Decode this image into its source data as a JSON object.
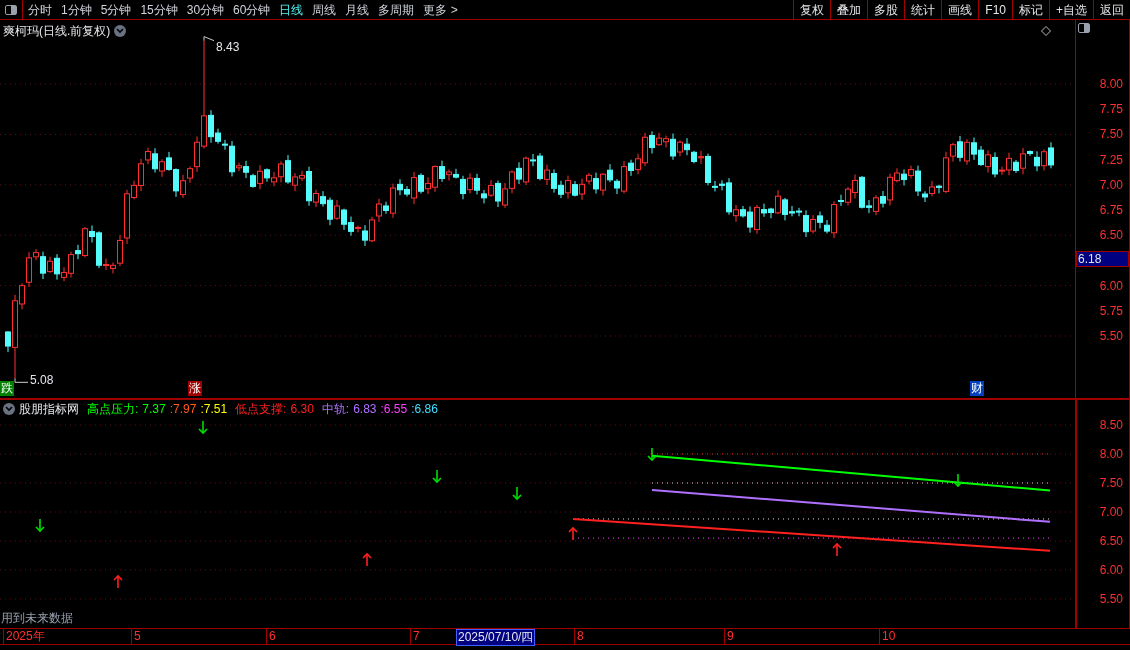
{
  "toolbar": {
    "tabs": [
      {
        "label": "分时",
        "selected": false
      },
      {
        "label": "1分钟",
        "selected": false
      },
      {
        "label": "5分钟",
        "selected": false
      },
      {
        "label": "15分钟",
        "selected": false
      },
      {
        "label": "30分钟",
        "selected": false
      },
      {
        "label": "60分钟",
        "selected": false
      },
      {
        "label": "日线",
        "selected": true
      },
      {
        "label": "周线",
        "selected": false
      },
      {
        "label": "月线",
        "selected": false
      },
      {
        "label": "多周期",
        "selected": false
      },
      {
        "label": "更多 >",
        "selected": false
      }
    ],
    "buttons": [
      "复权",
      "叠加",
      "多股",
      "统计",
      "画线",
      "F10",
      "标记",
      "+自选",
      "返回"
    ]
  },
  "main_chart": {
    "title": "爽柯玛(日线.前复权)",
    "high_label": "8.43",
    "low_label": "5.08",
    "y_axis": [
      "8.00",
      "7.75",
      "7.50",
      "7.25",
      "7.00",
      "6.75",
      "6.50",
      "6.00",
      "5.75",
      "5.50"
    ],
    "current_price": "6.18",
    "markers": [
      {
        "text": "跌",
        "kind": "fall"
      },
      {
        "text": "涨",
        "kind": "rise"
      },
      {
        "text": "财",
        "kind": "finance"
      }
    ]
  },
  "indicator": {
    "name": "股朋指标网",
    "groups": [
      {
        "label": "高点压力:",
        "values": [
          {
            "text": "7.37",
            "color": "#00ff00"
          },
          {
            "text": ":7.97",
            "color": "#ff5a1e"
          },
          {
            "text": ":7.51",
            "color": "#ffff00"
          }
        ]
      },
      {
        "label": "低点支撑:",
        "values": [
          {
            "text": "6.30",
            "color": "#ff2020"
          }
        ]
      },
      {
        "label": "中轨:",
        "values": [
          {
            "text": "6.83",
            "color": "#b070ff"
          },
          {
            "text": ":6.55",
            "color": "#ff40ff"
          },
          {
            "text": ":6.86",
            "color": "#40e0ff"
          }
        ]
      }
    ],
    "y_axis": [
      "8.50",
      "8.00",
      "7.50",
      "7.00",
      "6.50",
      "6.00",
      "5.50"
    ]
  },
  "note": "用到未来数据",
  "date_axis": [
    {
      "label": "2025年",
      "selected": false
    },
    {
      "label": "5",
      "selected": false
    },
    {
      "label": "6",
      "selected": false
    },
    {
      "label": "7",
      "selected": false
    },
    {
      "label": "2025/07/10/四",
      "selected": true
    },
    {
      "label": "8",
      "selected": false
    },
    {
      "label": "9",
      "selected": false
    },
    {
      "label": "10",
      "selected": false
    }
  ]
}
